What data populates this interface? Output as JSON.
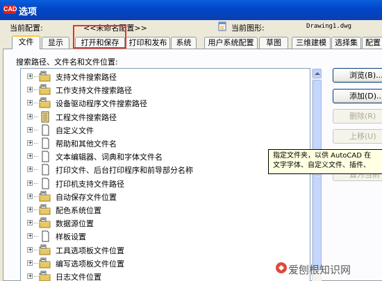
{
  "window": {
    "title": "选项",
    "logo_text": "CAD"
  },
  "profile": {
    "current_profile_label": "当前配置:",
    "current_profile_value": "<<未命名配置>>",
    "current_drawing_label": "当前图形:",
    "current_drawing_value": "Drawing1.dwg"
  },
  "tabs": [
    {
      "label": "文件",
      "active": true
    },
    {
      "label": "显示"
    },
    {
      "label": "打开和保存"
    },
    {
      "label": "打印和发布"
    },
    {
      "label": "系统"
    },
    {
      "label": "用户系统配置"
    },
    {
      "label": "草图"
    },
    {
      "label": "三维建模"
    },
    {
      "label": "选择集"
    },
    {
      "label": "配置"
    }
  ],
  "files_panel": {
    "label": "搜索路径、文件名和文件位置:",
    "items": [
      {
        "label": "支持文件搜索路径",
        "icon": "folder-icon"
      },
      {
        "label": "工作支持文件搜索路径",
        "icon": "folder-icon"
      },
      {
        "label": "设备驱动程序文件搜索路径",
        "icon": "folder-icon"
      },
      {
        "label": "工程文件搜索路径",
        "icon": "project-file-icon"
      },
      {
        "label": "自定义文件",
        "icon": "document-icon"
      },
      {
        "label": "帮助和其他文件名",
        "icon": "document-icon"
      },
      {
        "label": "文本编辑器、词典和字体文件名",
        "icon": "document-icon"
      },
      {
        "label": "打印文件、后台打印程序和前导部分名称",
        "icon": "document-icon"
      },
      {
        "label": "打印机支持文件路径",
        "icon": "document-icon"
      },
      {
        "label": "自动保存文件位置",
        "icon": "folder-icon"
      },
      {
        "label": "配色系统位置",
        "icon": "folder-icon"
      },
      {
        "label": "数据源位置",
        "icon": "folder-icon"
      },
      {
        "label": "样板设置",
        "icon": "document-icon"
      },
      {
        "label": "工具选项板文件位置",
        "icon": "folder-icon"
      },
      {
        "label": "编写选项板文件位置",
        "icon": "folder-icon"
      },
      {
        "label": "日志文件位置",
        "icon": "folder-icon"
      }
    ]
  },
  "buttons": {
    "browse": "浏览(B)...",
    "add": "添加(D)...",
    "remove": "删除(R)",
    "move_up": "上移(U)",
    "set_current": "置为当前"
  },
  "tooltip": {
    "line1": "指定文件夹，以供 AutoCAD 在",
    "line2": "文字字体、自定义文件、插件、"
  },
  "watermark": {
    "text": "爱刨根知识网"
  },
  "colors": {
    "title_bar": "#0a5fdc",
    "dialog_bg": "#ece9d8",
    "highlight_box": "#e53228",
    "tooltip_bg": "#ffffe1",
    "folder": "#e8c860"
  }
}
